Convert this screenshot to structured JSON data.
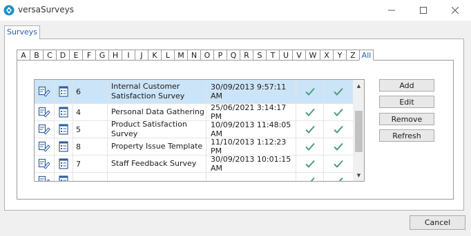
{
  "window": {
    "title": "versaSurveys",
    "accent": "#1f5fb4"
  },
  "tabs": [
    {
      "label": "Surveys",
      "active": true
    }
  ],
  "letter_filter": {
    "letters": [
      "A",
      "B",
      "C",
      "D",
      "E",
      "F",
      "G",
      "H",
      "I",
      "J",
      "K",
      "L",
      "M",
      "N",
      "O",
      "P",
      "Q",
      "R",
      "S",
      "T",
      "U",
      "V",
      "W",
      "X",
      "Y",
      "Z",
      "All"
    ],
    "selected": "All"
  },
  "surveys": {
    "rows": [
      {
        "id": "6",
        "name": "Internal Customer Satisfaction Survey",
        "date": "30/09/2013 9:57:11 AM",
        "check_a": true,
        "check_b": true,
        "selected": true
      },
      {
        "id": "4",
        "name": "Personal Data Gathering",
        "date": "25/06/2021 3:14:17 PM",
        "check_a": true,
        "check_b": true,
        "selected": false
      },
      {
        "id": "5",
        "name": "Product Satisfaction Survey",
        "date": "10/09/2013 11:48:05 AM",
        "check_a": true,
        "check_b": true,
        "selected": false
      },
      {
        "id": "8",
        "name": "Property Issue Template",
        "date": "11/10/2013 1:12:23 PM",
        "check_a": true,
        "check_b": true,
        "selected": false
      },
      {
        "id": "7",
        "name": "Staff Feedback Survey",
        "date": "30/09/2013 10:01:15 AM",
        "check_a": true,
        "check_b": true,
        "selected": false
      }
    ],
    "check_color": "#4a9d7e"
  },
  "actions": {
    "add": "Add",
    "edit": "Edit",
    "remove": "Remove",
    "refresh": "Refresh"
  },
  "footer": {
    "cancel": "Cancel"
  }
}
